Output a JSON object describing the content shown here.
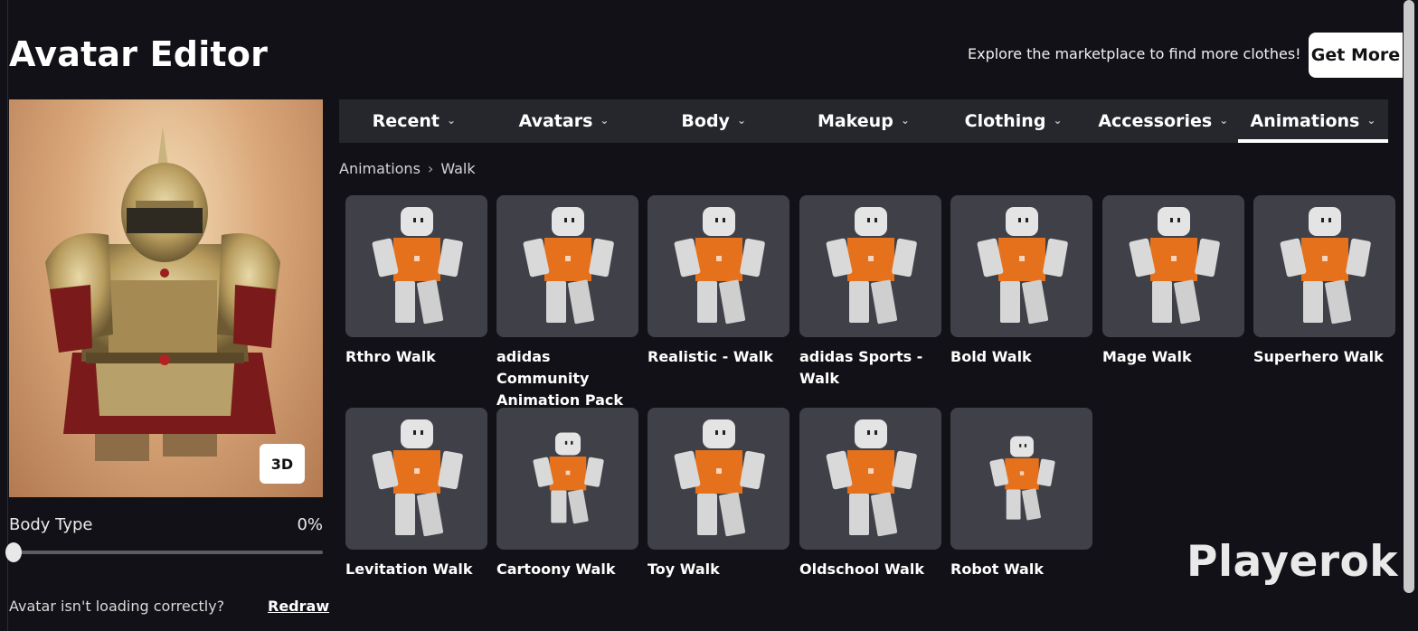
{
  "header": {
    "title": "Avatar Editor",
    "promo_text": "Explore the marketplace to find more clothes!",
    "get_more_label": "Get More"
  },
  "preview": {
    "view_mode_label": "3D"
  },
  "body_type": {
    "label": "Body Type",
    "value_text": "0%",
    "value": 0
  },
  "footer": {
    "message": "Avatar isn't loading correctly?",
    "redraw_label": "Redraw"
  },
  "tabs": [
    {
      "label": "Recent",
      "active": false
    },
    {
      "label": "Avatars",
      "active": false
    },
    {
      "label": "Body",
      "active": false
    },
    {
      "label": "Makeup",
      "active": false
    },
    {
      "label": "Clothing",
      "active": false
    },
    {
      "label": "Accessories",
      "active": false
    },
    {
      "label": "Animations",
      "active": true
    }
  ],
  "breadcrumb": {
    "parent": "Animations",
    "current": "Walk"
  },
  "items": [
    {
      "name": "Rthro Walk",
      "label_lines": [
        "Rthro Walk"
      ]
    },
    {
      "name": "adidas Community Animation Pack",
      "label_lines": [
        "adidas Community",
        "Animation Pack"
      ]
    },
    {
      "name": "Realistic - Walk",
      "label_lines": [
        "Realistic - Walk"
      ]
    },
    {
      "name": "adidas Sports - Walk",
      "label_lines": [
        "adidas Sports -",
        "Walk"
      ]
    },
    {
      "name": "Bold Walk",
      "label_lines": [
        "Bold Walk"
      ]
    },
    {
      "name": "Mage Walk",
      "label_lines": [
        "Mage Walk"
      ]
    },
    {
      "name": "Superhero Walk",
      "label_lines": [
        "Superhero Walk"
      ]
    },
    {
      "name": "Levitation Walk",
      "label_lines": [
        "Levitation Walk"
      ]
    },
    {
      "name": "Cartoony Walk",
      "label_lines": [
        "Cartoony Walk"
      ]
    },
    {
      "name": "Toy Walk",
      "label_lines": [
        "Toy Walk"
      ]
    },
    {
      "name": "Oldschool Walk",
      "label_lines": [
        "Oldschool Walk"
      ]
    },
    {
      "name": "Robot Walk",
      "label_lines": [
        "Robot Walk"
      ]
    }
  ],
  "watermark": "Playerok",
  "colors": {
    "background": "#121117",
    "tab_bar": "#25272d",
    "tile": "#3f4048",
    "shirt_orange": "#e5711c"
  }
}
